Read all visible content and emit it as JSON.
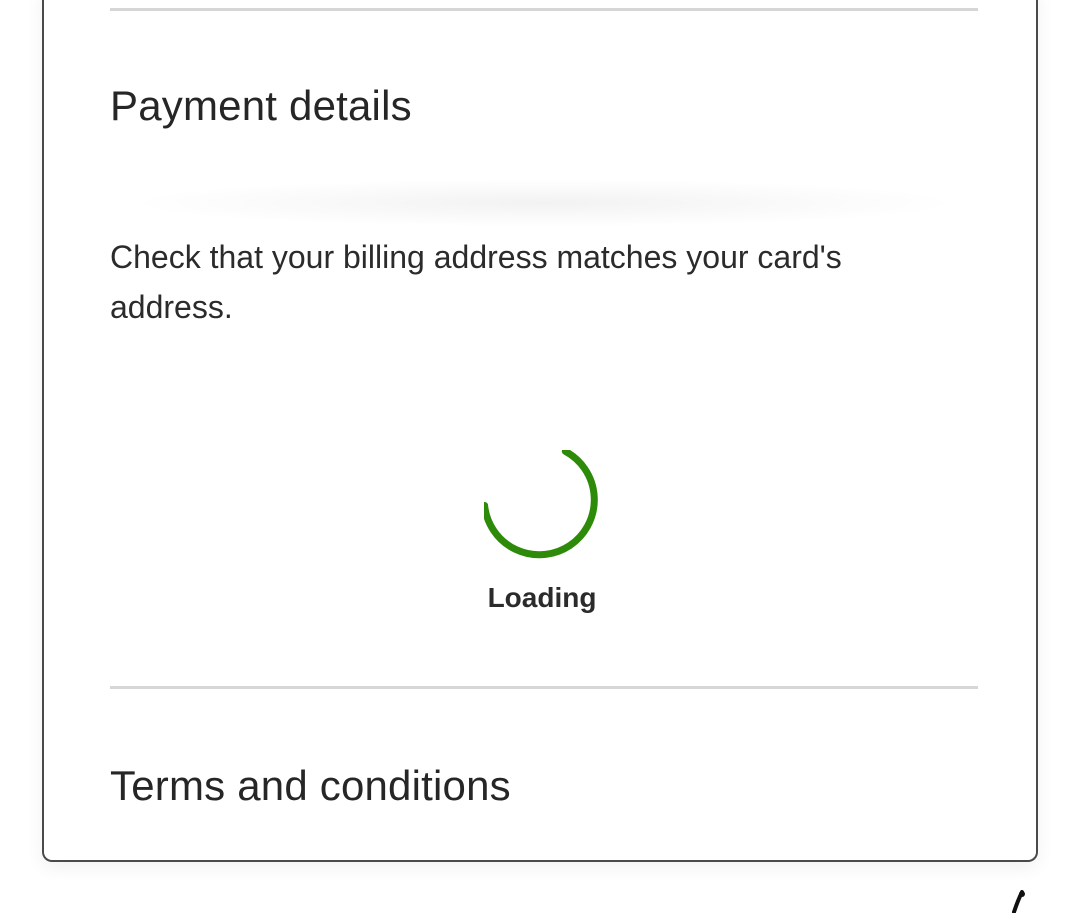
{
  "payment_section": {
    "title": "Payment details",
    "billing_notice": "Check that your billing address matches your card's address."
  },
  "loading": {
    "label": "Loading",
    "spinner_color": "#2e8b0a"
  },
  "terms_section": {
    "title": "Terms and conditions"
  },
  "colors": {
    "card_border": "#4a4a4a",
    "divider": "#d6d6d6",
    "text": "#2b2b2b"
  }
}
